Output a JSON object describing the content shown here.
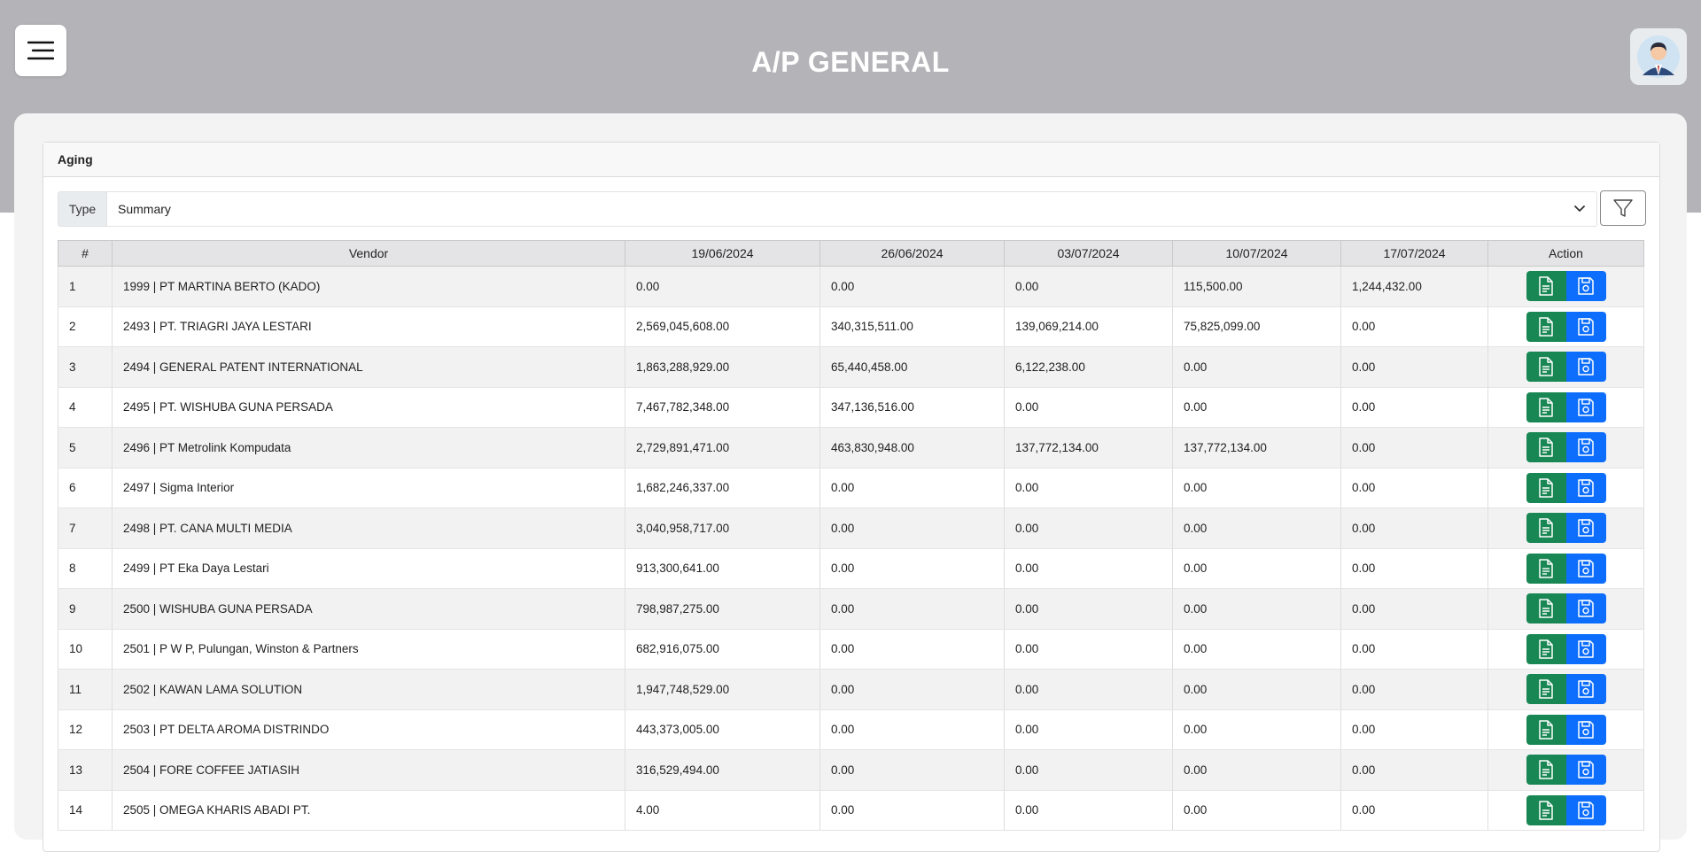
{
  "header": {
    "title": "A/P GENERAL"
  },
  "card": {
    "title": "Aging"
  },
  "filter": {
    "type_label": "Type",
    "type_value": "Summary"
  },
  "table": {
    "columns": [
      "#",
      "Vendor",
      "19/06/2024",
      "26/06/2024",
      "03/07/2024",
      "10/07/2024",
      "17/07/2024",
      "Action"
    ],
    "rows": [
      {
        "no": "1",
        "vendor": "1999 | PT MARTINA BERTO (KADO)",
        "c1": "0.00",
        "c2": "0.00",
        "c3": "0.00",
        "c4": "115,500.00",
        "c5": "1,244,432.00"
      },
      {
        "no": "2",
        "vendor": "2493 | PT. TRIAGRI JAYA LESTARI",
        "c1": "2,569,045,608.00",
        "c2": "340,315,511.00",
        "c3": "139,069,214.00",
        "c4": "75,825,099.00",
        "c5": "0.00"
      },
      {
        "no": "3",
        "vendor": "2494 | GENERAL PATENT INTERNATIONAL",
        "c1": "1,863,288,929.00",
        "c2": "65,440,458.00",
        "c3": "6,122,238.00",
        "c4": "0.00",
        "c5": "0.00"
      },
      {
        "no": "4",
        "vendor": "2495 | PT. WISHUBA GUNA PERSADA",
        "c1": "7,467,782,348.00",
        "c2": "347,136,516.00",
        "c3": "0.00",
        "c4": "0.00",
        "c5": "0.00"
      },
      {
        "no": "5",
        "vendor": "2496 | PT Metrolink Kompudata",
        "c1": "2,729,891,471.00",
        "c2": "463,830,948.00",
        "c3": "137,772,134.00",
        "c4": "137,772,134.00",
        "c5": "0.00"
      },
      {
        "no": "6",
        "vendor": "2497 | Sigma Interior",
        "c1": "1,682,246,337.00",
        "c2": "0.00",
        "c3": "0.00",
        "c4": "0.00",
        "c5": "0.00"
      },
      {
        "no": "7",
        "vendor": "2498 | PT. CANA MULTI MEDIA",
        "c1": "3,040,958,717.00",
        "c2": "0.00",
        "c3": "0.00",
        "c4": "0.00",
        "c5": "0.00"
      },
      {
        "no": "8",
        "vendor": "2499 | PT Eka Daya Lestari",
        "c1": "913,300,641.00",
        "c2": "0.00",
        "c3": "0.00",
        "c4": "0.00",
        "c5": "0.00"
      },
      {
        "no": "9",
        "vendor": "2500 | WISHUBA GUNA PERSADA",
        "c1": "798,987,275.00",
        "c2": "0.00",
        "c3": "0.00",
        "c4": "0.00",
        "c5": "0.00"
      },
      {
        "no": "10",
        "vendor": "2501 | P W P, Pulungan, Winston & Partners",
        "c1": "682,916,075.00",
        "c2": "0.00",
        "c3": "0.00",
        "c4": "0.00",
        "c5": "0.00"
      },
      {
        "no": "11",
        "vendor": "2502 | KAWAN LAMA SOLUTION",
        "c1": "1,947,748,529.00",
        "c2": "0.00",
        "c3": "0.00",
        "c4": "0.00",
        "c5": "0.00"
      },
      {
        "no": "12",
        "vendor": "2503 | PT DELTA AROMA DISTRINDO",
        "c1": "443,373,005.00",
        "c2": "0.00",
        "c3": "0.00",
        "c4": "0.00",
        "c5": "0.00"
      },
      {
        "no": "13",
        "vendor": "2504 | FORE COFFEE JATIASIH",
        "c1": "316,529,494.00",
        "c2": "0.00",
        "c3": "0.00",
        "c4": "0.00",
        "c5": "0.00"
      },
      {
        "no": "14",
        "vendor": "2505 | OMEGA KHARIS ABADI PT.",
        "c1": "4.00",
        "c2": "0.00",
        "c3": "0.00",
        "c4": "0.00",
        "c5": "0.00"
      }
    ]
  },
  "icons": {
    "menu": "menu-icon",
    "avatar": "user-avatar-icon",
    "dropdown": "chevron-down-icon",
    "filter": "filter-icon",
    "document": "document-icon",
    "save": "save-icon"
  },
  "colors": {
    "header_bg": "#b3b3b8",
    "doc_button": "#198754",
    "save_button": "#0d6efd"
  }
}
